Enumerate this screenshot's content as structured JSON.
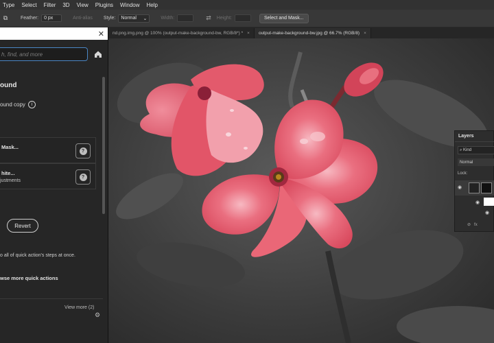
{
  "menu": [
    "Type",
    "Select",
    "Filter",
    "3D",
    "View",
    "Plugins",
    "Window",
    "Help"
  ],
  "options": {
    "feather_label": "Feather:",
    "feather_value": "0 px",
    "anti_alias": "Anti-alias",
    "style_label": "Style:",
    "style_value": "Normal",
    "width_label": "Width:",
    "height_label": "Height:",
    "select_mask_button": "Select and Mask..."
  },
  "tabs": [
    {
      "label": "nd.png.img.png @ 100% (output-make-background-bw, RGB/8*) *",
      "active": false
    },
    {
      "label": "output-make-background-bw.jpg @ 66.7% (RGB/8)",
      "active": true
    }
  ],
  "panel": {
    "search_placeholder": "h, find, and more",
    "section_title": "ound",
    "copy_label": "ound copy",
    "step1_title": "Mask...",
    "step2_title": "hite...",
    "step2_sub": "justments",
    "revert_label": "Revert",
    "note": "o all of quick action's steps at once.",
    "browse": "wse more quick actions",
    "view_more": "View more (2)"
  },
  "layers": {
    "title": "Layers",
    "kind": "Kind",
    "blend": "Normal",
    "lock": "Lock:"
  },
  "colors": {
    "accent": "#4b87c6",
    "petal": "#e45a6c",
    "petal_light": "#f39aa6",
    "stem": "#5a4a3a"
  },
  "icons": [
    "close-icon",
    "home-icon",
    "info-icon",
    "help-icon",
    "gear-icon",
    "eye-icon",
    "swap-icon"
  ]
}
